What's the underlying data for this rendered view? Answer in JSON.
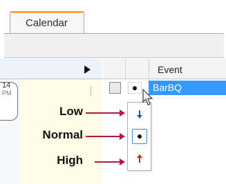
{
  "tab": {
    "label": "Calendar"
  },
  "calendar": {
    "day_number": "14",
    "day_sub": "PM"
  },
  "grid": {
    "column_event": "Event"
  },
  "row": {
    "event_name": "BarBQ"
  },
  "priority_dropdown": {
    "options": [
      {
        "label": "Low",
        "icon": "down-arrow-icon",
        "color": "#1a4fd6"
      },
      {
        "label": "Normal",
        "icon": "dot-icon",
        "color": "#111111"
      },
      {
        "label": "High",
        "icon": "up-arrow-icon",
        "color": "#d81b1b"
      }
    ],
    "selected": "Normal"
  },
  "colors": {
    "accent_tab": "#f2a93b",
    "selection": "#3399ff",
    "callout_arrow": "#b5163c"
  }
}
